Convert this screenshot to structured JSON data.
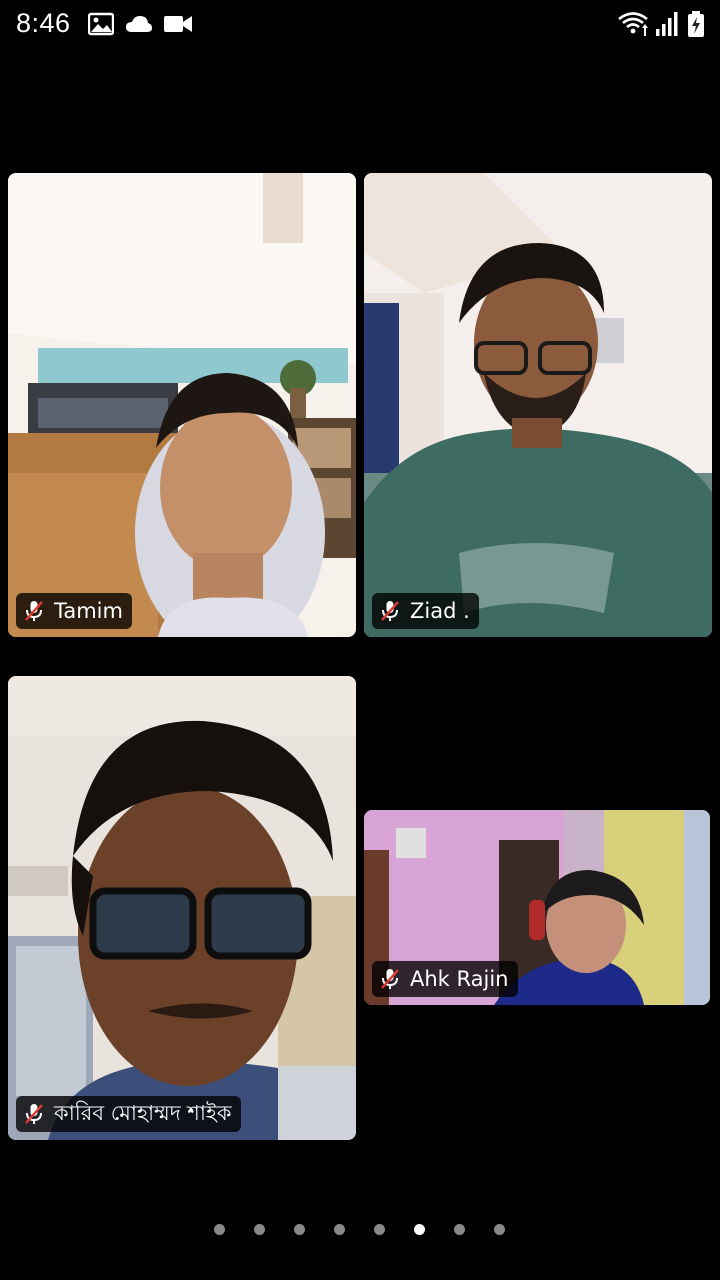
{
  "status_bar": {
    "time": "8:46",
    "left_icons": [
      "image-icon",
      "cloud-icon",
      "video-camera-icon"
    ],
    "right_icons": [
      "wifi-icon",
      "cellular-signal-icon",
      "battery-charging-icon"
    ]
  },
  "participants": [
    {
      "name": "Tamim",
      "mic": "muted",
      "icon": "mic-muted-icon"
    },
    {
      "name": "Ziad .",
      "mic": "muted",
      "icon": "mic-muted-icon"
    },
    {
      "name": "কারিব মোহাম্মদ শাইক",
      "mic": "muted",
      "icon": "mic-muted-icon"
    },
    {
      "name": "Ahk Rajin",
      "mic": "muted",
      "icon": "mic-muted-icon"
    }
  ],
  "pagination": {
    "total": 8,
    "active_index": 5
  },
  "colors": {
    "background": "#000000",
    "badge_bg": "rgba(0,0,0,0.78)",
    "mute_slash": "#e53935",
    "dot_active": "#ffffff",
    "dot_inactive": "#8a8a8a"
  }
}
